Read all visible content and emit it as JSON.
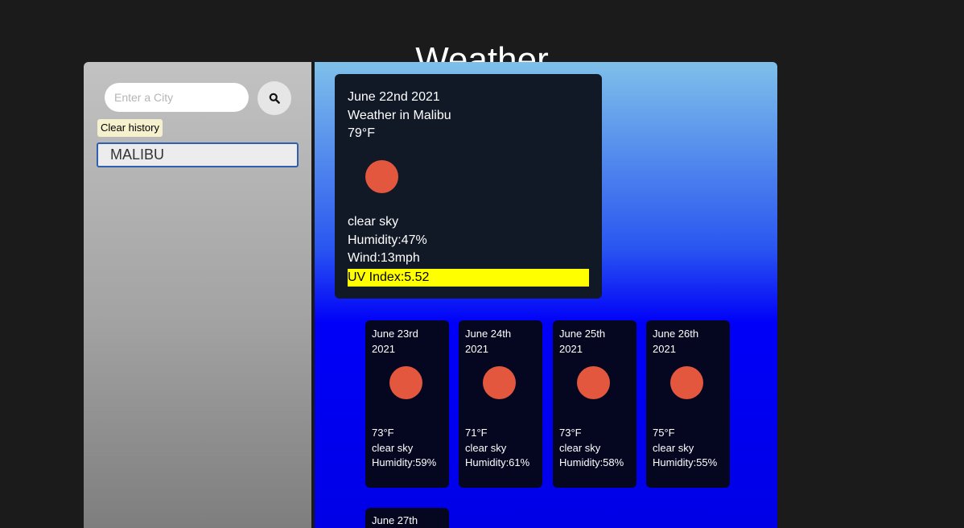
{
  "page": {
    "title": "Weather"
  },
  "search": {
    "placeholder": "Enter a City",
    "value": ""
  },
  "sidebar": {
    "clear_label": "Clear history",
    "history": [
      "MALIBU"
    ]
  },
  "current": {
    "date": "June 22nd 2021",
    "location": "Weather in Malibu",
    "temp": "79°F",
    "icon": "sun-icon",
    "description": "clear sky",
    "humidity": "Humidity:47%",
    "wind": "Wind:13mph",
    "uv": "UV Index:5.52",
    "uv_color": "#ffff00"
  },
  "forecast": [
    {
      "date_line1": "June 23rd",
      "date_line2": "2021",
      "temp": "73°F",
      "description": "clear sky",
      "humidity": "Humidity:59%"
    },
    {
      "date_line1": "June 24th",
      "date_line2": "2021",
      "temp": "71°F",
      "description": "clear sky",
      "humidity": "Humidity:61%"
    },
    {
      "date_line1": "June 25th",
      "date_line2": "2021",
      "temp": "73°F",
      "description": "clear sky",
      "humidity": "Humidity:58%"
    },
    {
      "date_line1": "June 26th",
      "date_line2": "2021",
      "temp": "75°F",
      "description": "clear sky",
      "humidity": "Humidity:55%"
    },
    {
      "date_line1": "June 27th"
    }
  ],
  "colors": {
    "background": "#1b1b1b",
    "sun": "#e3573e",
    "card": "#111826",
    "main_gradient_top": "#7ec0ea",
    "main_gradient_bottom": "#0000f8"
  }
}
